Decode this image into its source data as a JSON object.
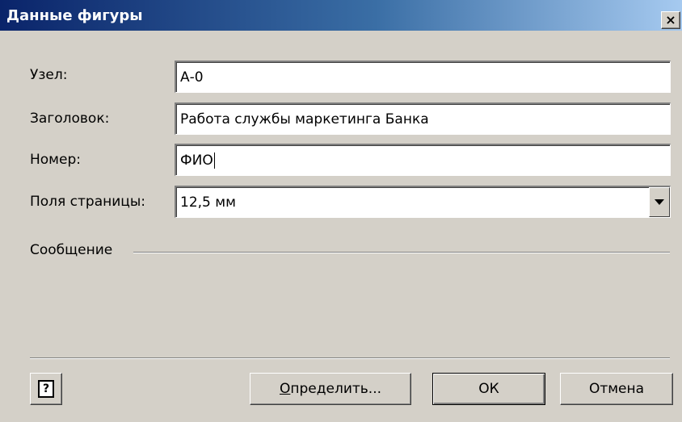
{
  "dialog": {
    "title": "Данные фигуры",
    "close_glyph": "×"
  },
  "fields": {
    "node": {
      "label": "Узел:",
      "value": "А-0"
    },
    "heading": {
      "label": "Заголовок:",
      "value": "Работа службы маркетинга Банка"
    },
    "number": {
      "label": "Номер:",
      "value": "ФИО"
    },
    "margins": {
      "label": "Поля страницы:",
      "value": "12,5 мм"
    }
  },
  "message": {
    "label": "Сообщение"
  },
  "buttons": {
    "help_glyph": "?",
    "define_accel": "О",
    "define_rest": "пределить...",
    "ok": "ОК",
    "cancel": "Отмена"
  },
  "icons": {
    "help": "help-icon",
    "close": "close-icon",
    "dropdown": "chevron-down-icon"
  },
  "colors": {
    "titlebar_start": "#0a246a",
    "titlebar_end": "#a6caf0",
    "dialog_bg": "#d4d0c8"
  }
}
